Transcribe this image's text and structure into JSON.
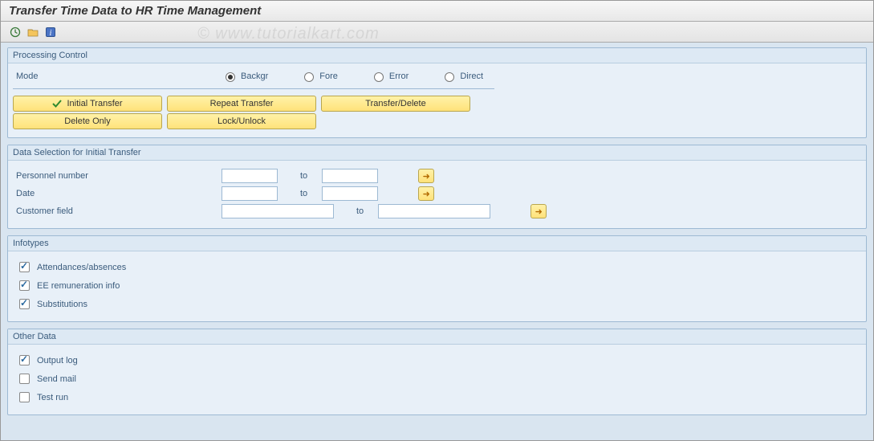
{
  "title": "Transfer Time Data to HR Time Management",
  "watermark": "© www.tutorialkart.com",
  "toolbar": {
    "execute": "Execute",
    "variant": "Get Variant",
    "info": "Information"
  },
  "processing": {
    "header": "Processing Control",
    "mode_label": "Mode",
    "modes": {
      "backgr": "Backgr",
      "fore": "Fore",
      "error": "Error",
      "direct": "Direct"
    },
    "selected": "backgr",
    "buttons": {
      "initial": "Initial Transfer",
      "repeat": "Repeat Transfer",
      "transfer_delete": "Transfer/Delete",
      "delete_only": "Delete Only",
      "lock_unlock": "Lock/Unlock"
    }
  },
  "selection": {
    "header": "Data Selection for Initial Transfer",
    "to_label": "to",
    "fields": [
      {
        "label": "Personnel number",
        "low": "",
        "high": "",
        "width": "small"
      },
      {
        "label": "Date",
        "low": "",
        "high": "",
        "width": "small"
      },
      {
        "label": "Customer field",
        "low": "",
        "high": "",
        "width": "med"
      }
    ]
  },
  "infotypes": {
    "header": "Infotypes",
    "items": [
      {
        "label": "Attendances/absences",
        "checked": true
      },
      {
        "label": "EE remuneration info",
        "checked": true
      },
      {
        "label": "Substitutions",
        "checked": true
      }
    ]
  },
  "other": {
    "header": "Other Data",
    "items": [
      {
        "label": "Output log",
        "checked": true
      },
      {
        "label": "Send mail",
        "checked": false
      },
      {
        "label": "Test run",
        "checked": false
      }
    ]
  }
}
